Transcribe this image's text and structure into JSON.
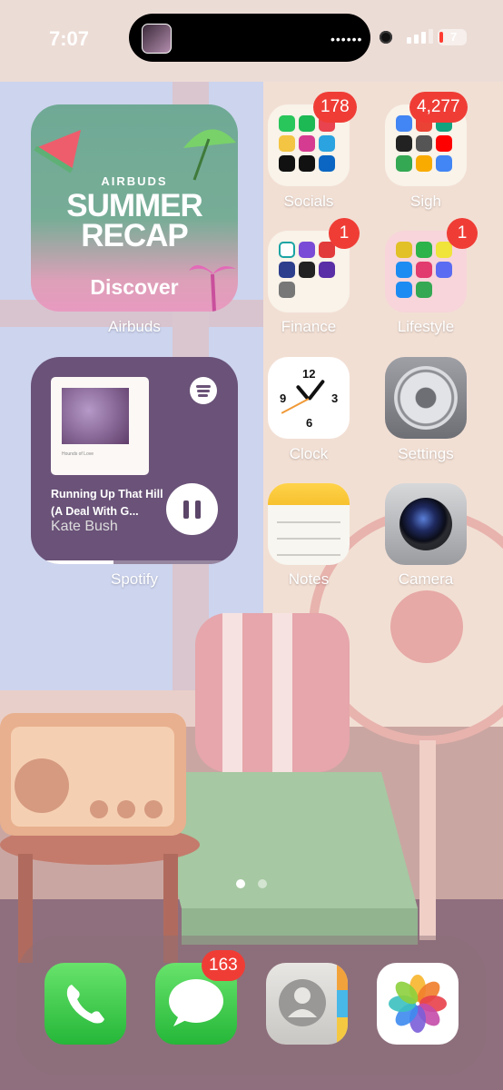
{
  "status_bar": {
    "time": "7:07",
    "battery": "7"
  },
  "widgets": {
    "airbuds": {
      "brand": "AIRBUDS",
      "line1": "SUMMER",
      "line2": "RECAP",
      "action": "Discover",
      "label": "Airbuds"
    },
    "spotify": {
      "cover_title": "Hounds of Love",
      "song": "Running Up That Hill (A Deal With G...",
      "artist": "Kate Bush",
      "progress": 0.4,
      "label": "Spotify"
    }
  },
  "apps": [
    {
      "name": "Socials",
      "badge": "178"
    },
    {
      "name": "Sigh",
      "badge": "4,277"
    },
    {
      "name": "Finance",
      "badge": "1"
    },
    {
      "name": "Lifestyle",
      "badge": "1"
    },
    {
      "name": "Clock"
    },
    {
      "name": "Settings"
    },
    {
      "name": "Notes"
    },
    {
      "name": "Camera"
    }
  ],
  "dock": [
    {
      "name": "Phone"
    },
    {
      "name": "Messages",
      "badge": "163"
    },
    {
      "name": "Contacts"
    },
    {
      "name": "Photos"
    }
  ],
  "page_dots": {
    "count": 2,
    "active": 1
  },
  "colors": {
    "badge": "#ef3d36",
    "spotify_bg": "#6a5278",
    "green": "#25b739"
  }
}
